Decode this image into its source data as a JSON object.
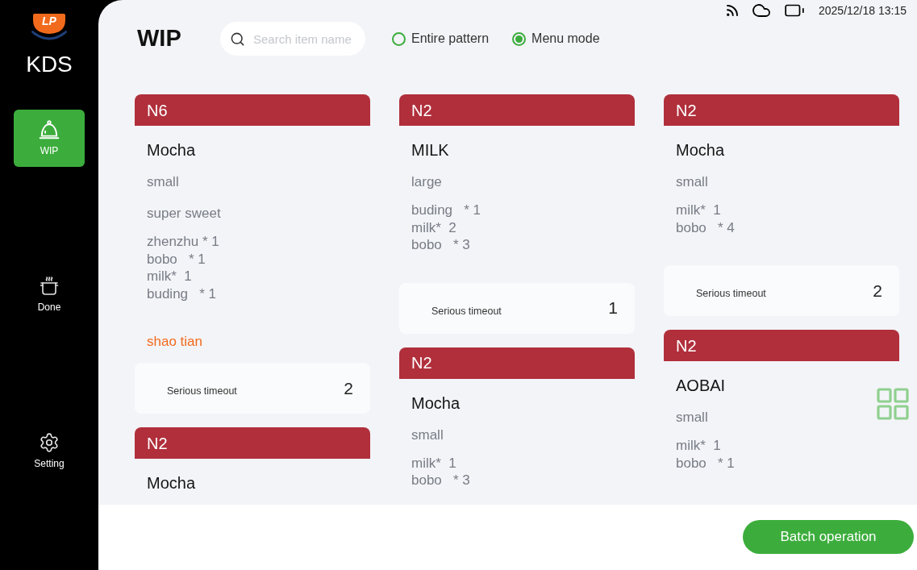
{
  "sidebar": {
    "logo": {
      "text": "LP"
    },
    "app_name": "KDS",
    "items": [
      {
        "kind": "wip",
        "label": "WIP",
        "selected": true
      },
      {
        "kind": "done",
        "label": "Done",
        "selected": false
      },
      {
        "kind": "setting",
        "label": "Setting",
        "selected": false
      }
    ]
  },
  "status_bar": {
    "datetime": "2025/12/18 13:15"
  },
  "header": {
    "title": "WIP",
    "search": {
      "placeholder": "Search item name"
    },
    "modes": [
      {
        "label": "Entire pattern",
        "selected": false
      },
      {
        "label": "Menu mode",
        "selected": true
      }
    ]
  },
  "columns": [
    {
      "orders": [
        {
          "number": "N6",
          "item": "Mocha",
          "specs": [
            "small",
            "super sweet"
          ],
          "extras": [
            "zhenzhu * 1",
            "bobo   * 1",
            "milk*  1",
            "buding   * 1"
          ],
          "note": "shao tian",
          "timeout": {
            "label": "Serious timeout",
            "count": "2"
          }
        },
        {
          "number": "N2",
          "item": "Mocha"
        }
      ]
    },
    {
      "orders": [
        {
          "number": "N2",
          "item": "MILK",
          "specs": [
            "large"
          ],
          "extras": [
            "buding   * 1",
            "milk*  2",
            "bobo   * 3"
          ],
          "timeout": {
            "label": "Serious timeout",
            "count": "1"
          }
        },
        {
          "number": "N2",
          "item": "Mocha",
          "specs": [
            "small"
          ],
          "extras": [
            "milk*  1",
            "bobo   * 3"
          ]
        }
      ]
    },
    {
      "orders": [
        {
          "number": "N2",
          "item": "Mocha",
          "specs": [
            "small"
          ],
          "extras": [
            "milk*  1",
            "bobo   * 4"
          ],
          "timeout": {
            "label": "Serious timeout",
            "count": "2"
          }
        },
        {
          "number": "N2",
          "item": "AOBAI",
          "specs": [
            "small"
          ],
          "extras": [
            "milk*  1",
            "bobo   * 1"
          ]
        }
      ]
    }
  ],
  "footer": {
    "batch_button": "Batch operation"
  }
}
